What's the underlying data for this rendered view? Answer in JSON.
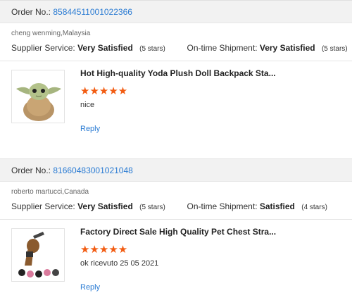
{
  "reviews": [
    {
      "order_label": "Order No.: ",
      "order_no": "85844511001022366",
      "buyer": "cheng wenming,Malaysia",
      "supplier_label": "Supplier Service:",
      "supplier_value": "Very Satisfied",
      "supplier_stars": "(5 stars)",
      "shipment_label": "On-time Shipment:",
      "shipment_value": "Very Satisfied",
      "shipment_stars": "(5 stars)",
      "product_title": "Hot High-quality Yoda Plush Doll Backpack Sta...",
      "rating": "★★★★★",
      "comment": "nice",
      "reply": "Reply",
      "thumb_icon": "yoda-plush-image"
    },
    {
      "order_label": "Order No.: ",
      "order_no": "81660483001021048",
      "buyer": "roberto martucci,Canada",
      "supplier_label": "Supplier Service:",
      "supplier_value": "Very Satisfied",
      "supplier_stars": "(5 stars)",
      "shipment_label": "On-time Shipment:",
      "shipment_value": "Satisfied",
      "shipment_stars": "(4 stars)",
      "product_title": "Factory Direct Sale High Quality Pet Chest Stra...",
      "rating": "★★★★★",
      "comment": "ok ricevuto 25 05 2021",
      "reply": "Reply",
      "thumb_icon": "dog-harness-image"
    }
  ],
  "colors": {
    "link": "#2a7bd3",
    "star": "#f25c12",
    "bar": "#f2f2f2"
  }
}
